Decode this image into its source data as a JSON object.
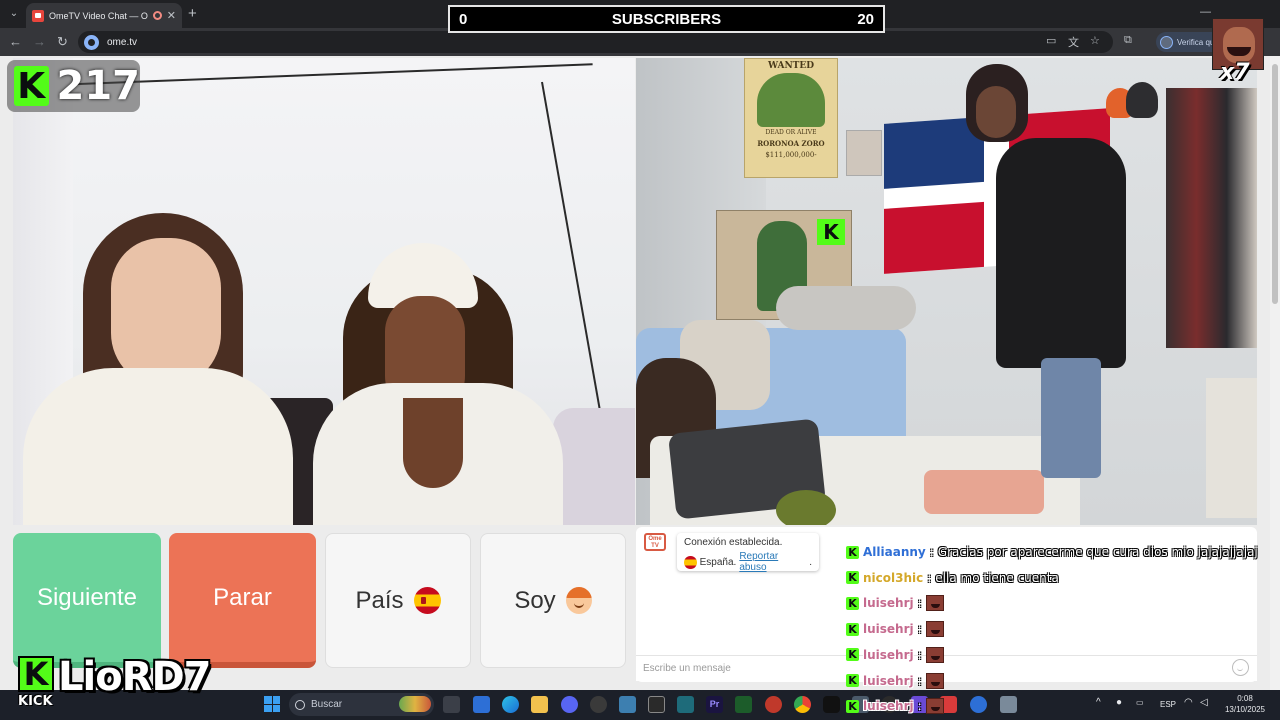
{
  "browser": {
    "tab_title": "OmeTV Video Chat — Ome",
    "url": "ome.tv",
    "profile_chip": "Verifica qu"
  },
  "overlay": {
    "subs_left": "0",
    "subs_title": "SUBSCRIBERS",
    "subs_right": "20",
    "kick_count": "217",
    "reaction_mult": "x7",
    "streamer_name": "LioRD7",
    "platform_label": "KICK"
  },
  "controls": {
    "next_label": "Siguiente",
    "stop_label": "Parar",
    "country_label": "País",
    "gender_label": "Soy"
  },
  "chat": {
    "logo_text": "Ome TV",
    "connection_text": "Conexión establecida.",
    "country_text": "España.",
    "report_link": "Reportar abuso",
    "report_suffix": ".",
    "input_placeholder": "Escribe un mensaje"
  },
  "kick_chat": [
    {
      "user": "Alliaanny",
      "sep": ":",
      "text": "Gracias por aparecerme que cura dios mio jajajajjajaj",
      "color": "#2f6fd6"
    },
    {
      "user": "nicol3hic",
      "sep": ":",
      "text": "ella mo tiene cuenta",
      "color": "#d4a82a"
    },
    {
      "user": "luisehrj",
      "sep": ":",
      "text": "",
      "color": "#c56a8e"
    },
    {
      "user": "luisehrj",
      "sep": ":",
      "text": "",
      "color": "#c56a8e"
    },
    {
      "user": "luisehrj",
      "sep": ":",
      "text": "",
      "color": "#c56a8e"
    },
    {
      "user": "luisehrj",
      "sep": ":",
      "text": "",
      "color": "#c56a8e"
    },
    {
      "user": "luisehrj",
      "sep": ":",
      "text": "",
      "color": "#c56a8e"
    }
  ],
  "poster": {
    "wanted": "WANTED",
    "dead_or_alive": "DEAD OR ALIVE",
    "name": "RORONOA ZORO",
    "bounty": "$111,000,000-"
  },
  "taskbar": {
    "search_placeholder": "Buscar",
    "language": "ESP",
    "time": "0:08",
    "date": "13/10/2025"
  },
  "colors": {
    "kick_green": "#53fc18",
    "next_green": "#6bd39b",
    "stop_red": "#ec7356"
  }
}
